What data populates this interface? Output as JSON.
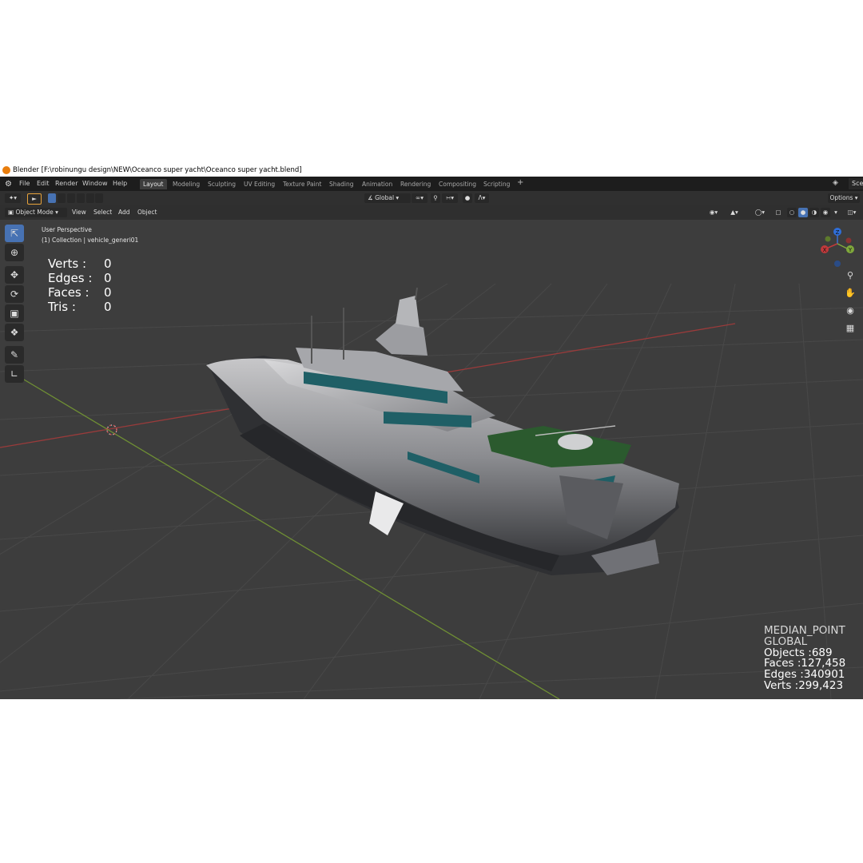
{
  "window": {
    "title": "Blender [F:\\robinungu design\\NEW\\Oceanco super yacht\\Oceanco super yacht.blend]"
  },
  "menu": [
    "File",
    "Edit",
    "Render",
    "Window",
    "Help"
  ],
  "workspaces": [
    {
      "label": "Layout",
      "active": true
    },
    {
      "label": "Modeling",
      "active": false
    },
    {
      "label": "Sculpting",
      "active": false
    },
    {
      "label": "UV Editing",
      "active": false
    },
    {
      "label": "Texture Paint",
      "active": false
    },
    {
      "label": "Shading",
      "active": false
    },
    {
      "label": "Animation",
      "active": false
    },
    {
      "label": "Rendering",
      "active": false
    },
    {
      "label": "Compositing",
      "active": false
    },
    {
      "label": "Scripting",
      "active": false
    }
  ],
  "scene_label": "Sce",
  "toolheader": {
    "orientation": "Global",
    "options": "Options"
  },
  "viewport_header": {
    "mode": "Object Mode",
    "menus": [
      "View",
      "Select",
      "Add",
      "Object"
    ]
  },
  "viewport": {
    "perspective": "User Perspective",
    "collection": "(1) Collection | vehicle_generi01",
    "selection_stats": [
      {
        "label": "Verts :",
        "value": "0"
      },
      {
        "label": "Edges :",
        "value": "0"
      },
      {
        "label": "Faces :",
        "value": "0"
      },
      {
        "label": "Tris :",
        "value": "0"
      }
    ],
    "gizmo_axes": {
      "x": "X",
      "y": "Y",
      "z": "Z"
    },
    "scene_stats": {
      "pivot": "MEDIAN_POINT",
      "orientation": "GLOBAL",
      "objects": "Objects :689",
      "faces": "Faces :127,458",
      "edges": "Edges :340901",
      "verts": "Verts :299,423"
    }
  },
  "colors": {
    "accent": "#4772b3",
    "viewport_bg": "#3d3d3d",
    "axis_x": "#c0393b",
    "axis_y": "#7fa83b",
    "gizmo_z": "#2f6ed8"
  }
}
